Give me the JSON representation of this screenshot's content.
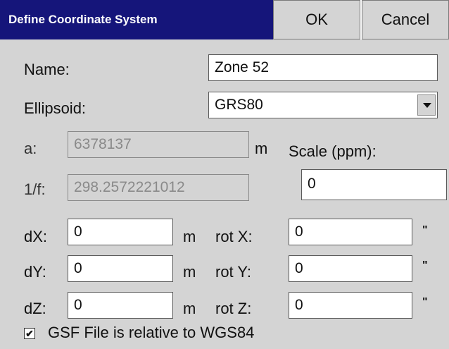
{
  "dialog": {
    "title": "Define Coordinate System",
    "ok_label": "OK",
    "cancel_label": "Cancel"
  },
  "name": {
    "label": "Name:",
    "value": "Zone 52"
  },
  "ellipsoid": {
    "label": "Ellipsoid:",
    "value": "GRS80"
  },
  "a": {
    "label": "a:",
    "value": "6378137",
    "unit": "m"
  },
  "inv_f": {
    "label": "1/f:",
    "value": "298.2572221012"
  },
  "scale": {
    "label": "Scale (ppm):",
    "value": "0"
  },
  "translations": [
    {
      "label": "dX:",
      "value": "0",
      "unit": "m"
    },
    {
      "label": "dY:",
      "value": "0",
      "unit": "m"
    },
    {
      "label": "dZ:",
      "value": "0",
      "unit": "m"
    }
  ],
  "rotations": [
    {
      "label": "rot X:",
      "value": "0",
      "unit": "\""
    },
    {
      "label": "rot Y:",
      "value": "0",
      "unit": "\""
    },
    {
      "label": "rot Z:",
      "value": "0",
      "unit": "\""
    }
  ],
  "gsf_checkbox": {
    "checked": true,
    "mark": "✔",
    "label": "GSF File is relative to WGS84"
  }
}
